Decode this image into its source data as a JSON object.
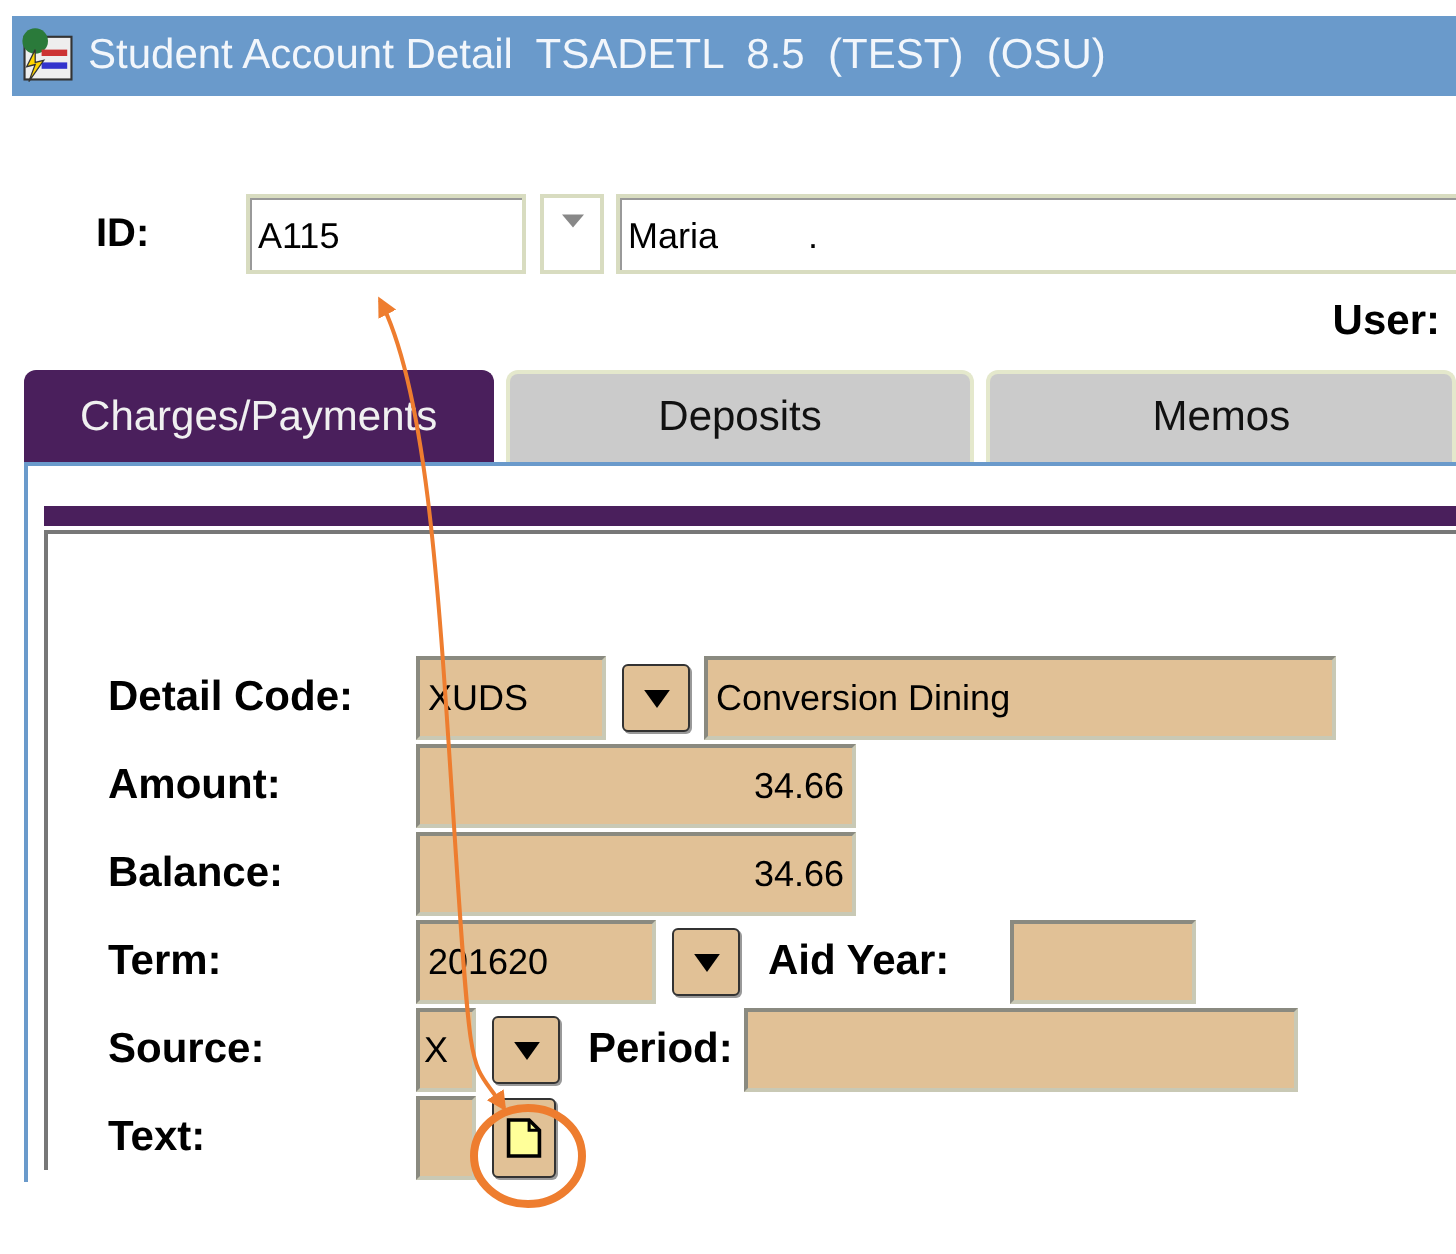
{
  "window": {
    "title": "Student Account Detail  TSADETL  8.5  (TEST)  (OSU)"
  },
  "key_block": {
    "id_label": "ID:",
    "id_value": "A115",
    "name_value": "Maria         .",
    "user_label": "User:"
  },
  "tabs": [
    {
      "label": "Charges/Payments",
      "selected": true
    },
    {
      "label": "Deposits",
      "selected": false
    },
    {
      "label": "Memos",
      "selected": false
    }
  ],
  "form_rows": [
    {
      "label": "Detail Code:",
      "items": [
        {
          "kind": "code",
          "value": "XUDS"
        },
        {
          "kind": "dropdown"
        },
        {
          "kind": "description",
          "value": "Conversion Dining"
        }
      ]
    },
    {
      "label": "Amount:",
      "items": [
        {
          "kind": "amount",
          "value": "34.66"
        }
      ]
    },
    {
      "label": "Balance:",
      "items": [
        {
          "kind": "amount",
          "value": "34.66"
        }
      ]
    },
    {
      "label": "Term:",
      "items": [
        {
          "kind": "term",
          "value": "201620"
        },
        {
          "kind": "dropdown"
        },
        {
          "kind": "label",
          "value": "Aid Year:"
        },
        {
          "kind": "year"
        }
      ]
    },
    {
      "label": "Source:",
      "items": [
        {
          "kind": "tiny",
          "value": "X"
        },
        {
          "kind": "dropdown"
        },
        {
          "kind": "label",
          "value": "Period:"
        },
        {
          "kind": "period"
        }
      ]
    },
    {
      "label": "Text:",
      "items": [
        {
          "kind": "tiny"
        },
        {
          "kind": "note"
        }
      ]
    }
  ]
}
